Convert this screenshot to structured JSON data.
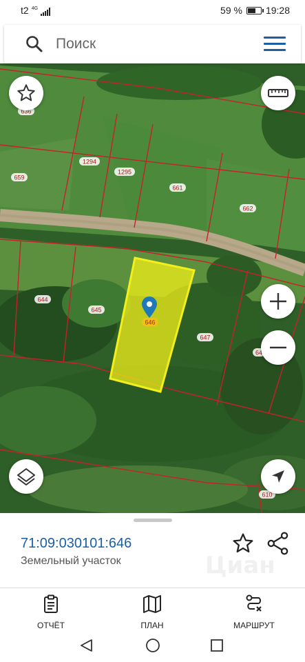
{
  "status_bar": {
    "carrier": "t2",
    "network": "4G",
    "battery_percent": "59 %",
    "battery_level": 0.59,
    "time": "19:28"
  },
  "search": {
    "placeholder": "Поиск"
  },
  "map": {
    "parcel_labels": [
      "636",
      "1294",
      "1295",
      "659",
      "661",
      "662",
      "644",
      "645",
      "646",
      "647",
      "64",
      "610"
    ],
    "selected_parcel_label": "646",
    "highlight_color": "#f2ef1a",
    "boundary_color": "#c8202a"
  },
  "map_controls": {
    "favorite": "star-icon",
    "ruler": "ruler-icon",
    "zoom_in": "plus-icon",
    "zoom_out": "minus-icon",
    "layers": "layers-icon",
    "locate": "navigation-arrow-icon"
  },
  "details": {
    "cadastral_number": "71:09:030101:646",
    "object_type": "Земельный участок",
    "watermark": "Циан"
  },
  "bottom_tabs": [
    {
      "label": "ОТЧЁТ",
      "icon": "report-clipboard-icon"
    },
    {
      "label": "ПЛАН",
      "icon": "map-plan-icon"
    },
    {
      "label": "МАРШРУТ",
      "icon": "route-icon"
    }
  ],
  "colors": {
    "accent": "#1a5fa8"
  }
}
